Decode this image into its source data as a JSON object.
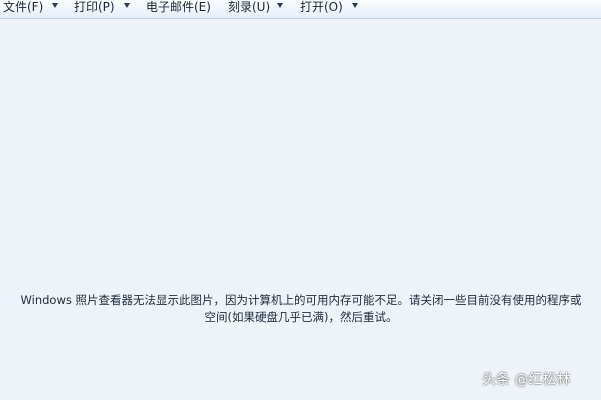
{
  "menu": {
    "file": "文件(F)",
    "print": "打印(P)",
    "email": "电子邮件(E)",
    "burn": "刻录(U)",
    "open": "打开(O)"
  },
  "message": {
    "line1": "Windows 照片查看器无法显示此图片，因为计算机上的可用内存可能不足。请关闭一些目前没有使用的程序或",
    "line2": "空间(如果硬盘几乎已满)，然后重试。"
  },
  "watermark": "头条 @红松林",
  "colors": {
    "background": "#eef3fa",
    "menubar": "#e6eef8",
    "text": "#1e2a3a"
  },
  "icons": {
    "menu_dropdown": "chevron-down-icon"
  }
}
